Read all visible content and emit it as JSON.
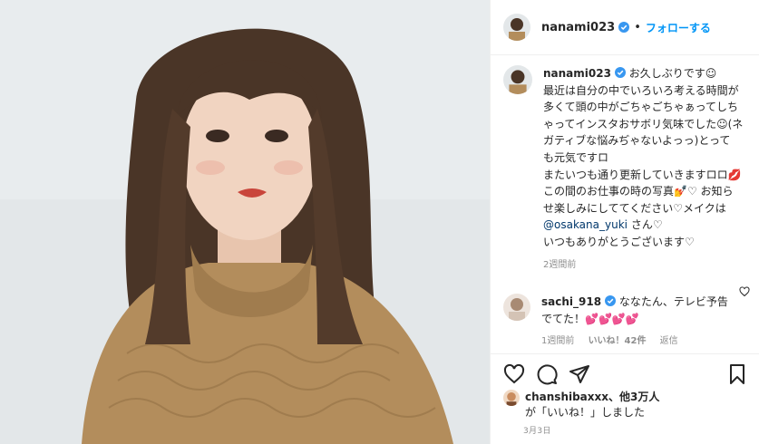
{
  "photo": {
    "description_icon": "portrait-photo"
  },
  "header": {
    "username": "nanami023",
    "separator": "•",
    "follow_label": "フォローする"
  },
  "caption": {
    "username": "nanami023",
    "lines": [
      "お久しぶりです☺",
      "最近は自分の中でいろいろ考える時間が",
      "多くて頭の中がごちゃごちゃぁってしち",
      "ゃってインスタおサボリ気味でした☺(ネ",
      "ガティブな悩みぢゃないよっっ)とって",
      "も元気ですロ",
      "またいつも通り更新していきますロロ💋",
      "この間のお仕事の時の写真💅♡ お知ら",
      "せ楽しみにしててください♡メイクは"
    ],
    "mention": "@osakana_yuki",
    "after_mention": " さん♡",
    "last_line": "いつもありがとうございます♡",
    "time": "2週間前"
  },
  "reply": {
    "username": "sachi_918",
    "text_line1": "ななたん、テレビ予告",
    "text_line2": "でてた！💕💕💕💕",
    "time": "1週間前",
    "likes": "いいね！42件",
    "reply_label": "返信"
  },
  "likes": {
    "user": "chanshibaxxx",
    "rest": "、他3万人",
    "line2": "が「いいね！」しました"
  },
  "date": "3月3日",
  "colors": {
    "accent": "#0095f6",
    "verified": "#3897f0",
    "muted": "#8e8e8e"
  },
  "icons": [
    "heart-icon",
    "comment-icon",
    "share-icon",
    "bookmark-icon",
    "verified-icon"
  ]
}
